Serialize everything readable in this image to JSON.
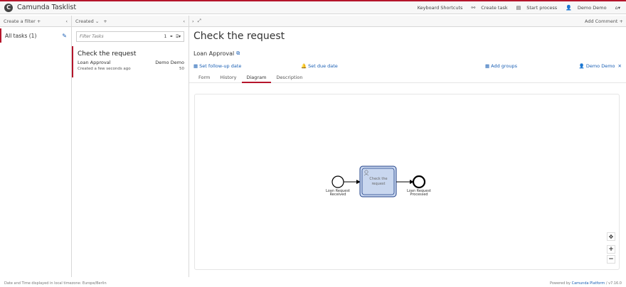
{
  "topbar": {
    "logo_glyph": "C",
    "app_title": "Camunda Tasklist",
    "links": {
      "keyboard_shortcuts": "Keyboard Shortcuts",
      "create_task": "Create task",
      "start_process": "Start process",
      "user": "Demo Demo"
    },
    "accent_color": "#b5152b"
  },
  "filters": {
    "header": "Create a filter +",
    "collapse_glyph": "‹",
    "items": [
      {
        "label": "All tasks (1)"
      }
    ]
  },
  "tasklist": {
    "sort_label": "Created",
    "add_sort": "+",
    "collapse_glyph": "‹",
    "search": {
      "placeholder": "Filter Tasks",
      "count": "1"
    },
    "tasks": [
      {
        "name": "Check the request",
        "process": "Loan Approval",
        "assignee": "Demo Demo",
        "created": "Created a few seconds ago",
        "priority": "50"
      }
    ]
  },
  "task": {
    "expand_glyph": "›",
    "add_comment": "Add Comment +",
    "title": "Check the request",
    "process_name": "Loan Approval",
    "actions": {
      "follow_up": "Set follow-up date",
      "due_date": "Set due date",
      "groups": "Add groups",
      "assignee": "Demo Demo"
    },
    "tabs": [
      "Form",
      "History",
      "Diagram",
      "Description"
    ],
    "active_tab": "Diagram"
  },
  "diagram": {
    "start_event_label": [
      "Loan Request",
      "Received"
    ],
    "task_label": [
      "Check the",
      "request"
    ],
    "end_event_label": [
      "Loan Request",
      "Processed"
    ],
    "zoom_controls": {
      "move": "✥",
      "zoom_in": "+",
      "zoom_out": "−"
    }
  },
  "footer": {
    "timezone_note": "Date and Time displayed in local timezone: Europe/Berlin",
    "powered_by": "Powered by ",
    "platform_link": "Camunda Platform",
    "version": " / v7.16.0"
  }
}
